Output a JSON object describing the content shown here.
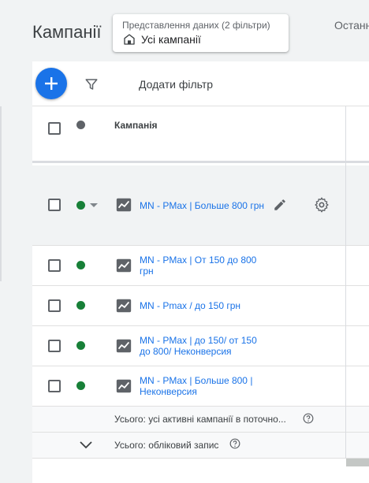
{
  "page": {
    "title": "Кампанії",
    "last_label": "Останн"
  },
  "view": {
    "caption": "Представлення даних (2 фільтри)",
    "value": "Усі кампанії"
  },
  "toolbar": {
    "add_filter": "Додати фільтр"
  },
  "table": {
    "column_campaign": "Кампанія",
    "rows": [
      {
        "name": "MN - PMax | Больше 800 грн",
        "status": "active"
      },
      {
        "name": "MN - PMax | От 150 до 800 грн",
        "status": "active"
      },
      {
        "name": "MN - Pmax / до 150 грн",
        "status": "active"
      },
      {
        "name": "MN - PMax | до 150/ от 150 до 800/ Неконверсия",
        "status": "active"
      },
      {
        "name": "MN - PMax | Больше 800 | Неконверсия",
        "status": "active"
      }
    ],
    "total_active": "Усього: усі активні кампанії в поточно...",
    "total_account": "Усього: обліковий запис"
  },
  "colors": {
    "accent": "#1a73e8",
    "status_active": "#188038"
  },
  "icons": [
    "home-icon",
    "add-icon",
    "filter-icon",
    "chart-icon",
    "edit-icon",
    "gear-icon",
    "help-icon",
    "chevron-down-icon"
  ]
}
